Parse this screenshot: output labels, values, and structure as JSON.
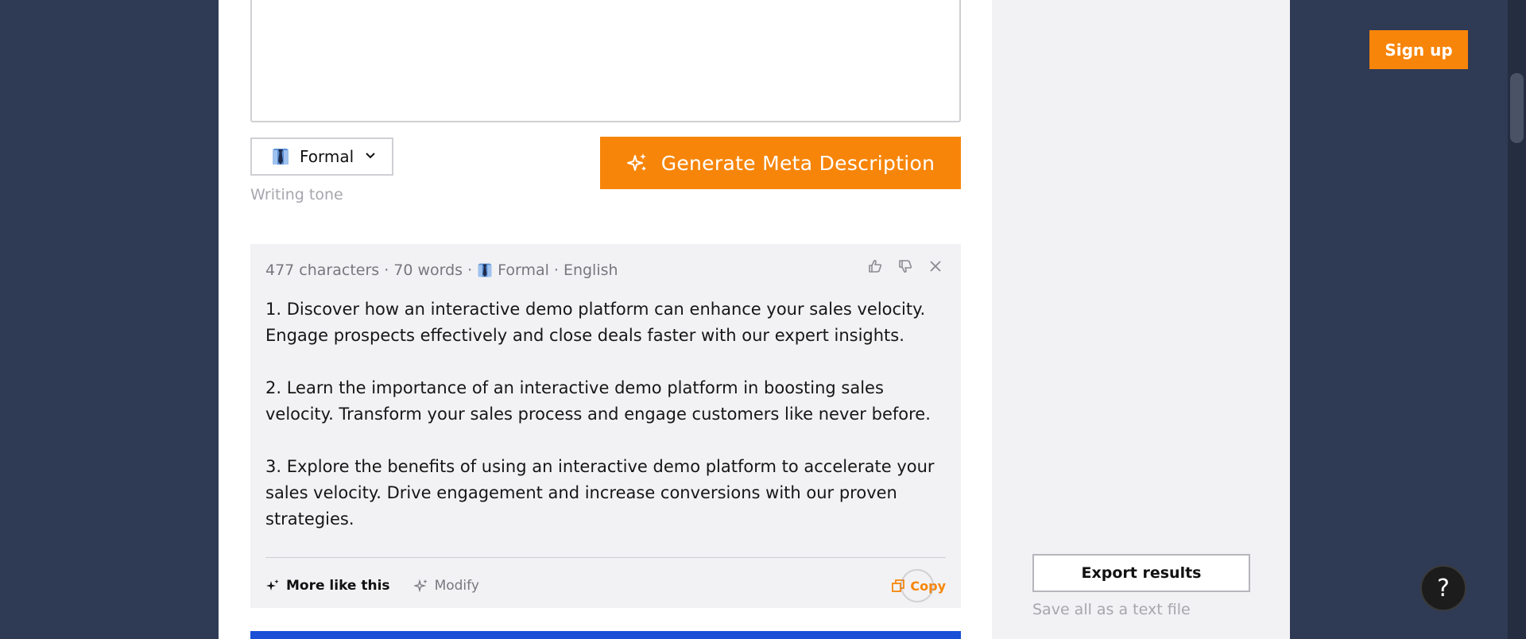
{
  "colors": {
    "accent": "#f7850a",
    "page_bg": "#2f3a55",
    "card_bg": "#f2f2f4",
    "blue_bar": "#1a4fd6"
  },
  "input": {
    "value": ""
  },
  "tone": {
    "selected": "Formal",
    "caption": "Writing tone",
    "icon": "necktie-icon"
  },
  "generate": {
    "label": "Generate Meta Description",
    "icon": "sparkles-icon"
  },
  "result": {
    "meta": {
      "characters": "477 characters",
      "sep1": "·",
      "words": "70 words",
      "sep2": "·",
      "tone": "Formal",
      "sep3": "·",
      "language": "English"
    },
    "paragraphs": [
      "1. Discover how an interactive demo platform can enhance your sales velocity. Engage prospects effectively and close deals faster with our expert insights.",
      "2. Learn the importance of an interactive demo platform in boosting sales velocity. Transform your sales process and engage customers like never before.",
      "3. Explore the benefits of using an interactive demo platform to accelerate your sales velocity. Drive engagement and increase conversions with our proven strategies."
    ],
    "actions": {
      "more_like_this": "More like this",
      "modify": "Modify",
      "copy": "Copy"
    }
  },
  "sidebar": {
    "export_label": "Export results",
    "export_caption": "Save all as a text file"
  },
  "header": {
    "signup_label": "Sign up"
  },
  "help": {
    "label": "?"
  }
}
